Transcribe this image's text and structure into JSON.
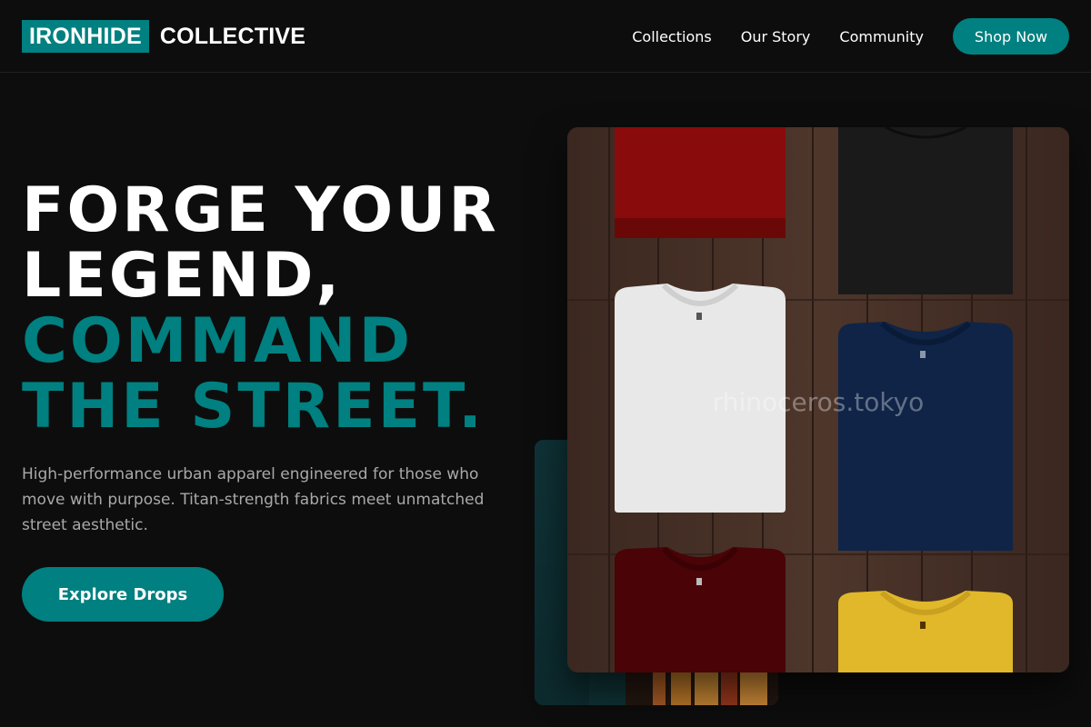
{
  "header": {
    "logo_primary": "IRONHIDE",
    "logo_secondary": "COLLECTIVE",
    "nav": [
      "Collections",
      "Our Story",
      "Community"
    ],
    "cta": "Shop Now"
  },
  "hero": {
    "headline_lines": [
      "FORGE YOUR",
      "LEGEND,"
    ],
    "headline_accent_lines": [
      "COMMAND",
      "THE STREET."
    ],
    "subcopy": "High-performance urban apparel engineered for those who move with purpose. Titan-strength fabrics meet unmatched street aesthetic.",
    "cta": "Explore Drops"
  },
  "images": {
    "main_alt_icon": "folded-tshirts-photo",
    "secondary_alt_icon": "clothing-rack-photo",
    "watermark": "rhinoceros.tokyo"
  },
  "colors": {
    "accent": "#008080",
    "background": "#0d0d0d",
    "muted_text": "#a9a9a9"
  }
}
